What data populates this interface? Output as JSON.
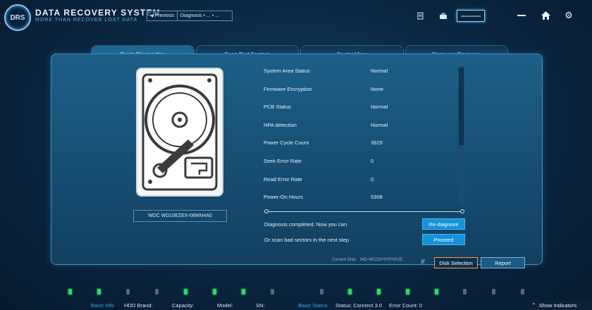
{
  "app": {
    "logo_text": "DRS",
    "title": "DATA RECOVERY SYSTEM",
    "subtitle": "MORE THAN RECOVER LOST DATA"
  },
  "nav": {
    "previous_label": "Previous",
    "breadcrumb": "Diagnosis • ... • ..."
  },
  "tabs": [
    {
      "label": "Quick Diagnostics",
      "active": true
    },
    {
      "label": "Scan Bad Sectors",
      "active": false
    },
    {
      "label": "Sector View",
      "active": false
    },
    {
      "label": "Firmware Recovery",
      "active": false
    }
  ],
  "disk": {
    "model": "WDC WD10EZEX-08WN4A0"
  },
  "status_items": [
    {
      "label": "System Area Status",
      "value": "Normal"
    },
    {
      "label": "Firmware Encryption",
      "value": "None"
    },
    {
      "label": "PCB Status",
      "value": "Normal"
    },
    {
      "label": "HPA detection",
      "value": "Normal"
    },
    {
      "label": "Power Cycle Count",
      "value": "3929"
    },
    {
      "label": "Seek Error Rate",
      "value": "0"
    },
    {
      "label": "Read Error Rate",
      "value": "0"
    },
    {
      "label": "Power-On Hours",
      "value": "5308"
    }
  ],
  "messages": {
    "completed": "Diagnosis completed. Now you can",
    "next_step": "Or scan bad sectors in the next step"
  },
  "buttons": {
    "rediagnose": "Re-diagnose",
    "proceed": "Proceed",
    "disk_selection": "Disk Selection",
    "report": "Report"
  },
  "current_disk": {
    "label": "Current Disk:",
    "value": "WD-WCC6Y0YPXRJE"
  },
  "indicators": [
    true,
    true,
    false,
    false,
    true,
    true,
    true,
    false,
    false,
    true,
    true,
    true,
    true,
    false,
    false,
    false
  ],
  "status_bar": {
    "basic_info": "Basic Info",
    "hdd_brand": "HDD Brand:",
    "capacity": "Capacity:",
    "model": "Model:",
    "sn": "SN:",
    "basic_status": "Basic Status",
    "status": "Status: Connect 3.0",
    "error_count": "Error Count: 0",
    "show_indicators": "Show Indicators"
  },
  "colors": {
    "accent": "#1592d8",
    "indicator_on": "#2edb5c",
    "highlight": "#f2a23a"
  }
}
